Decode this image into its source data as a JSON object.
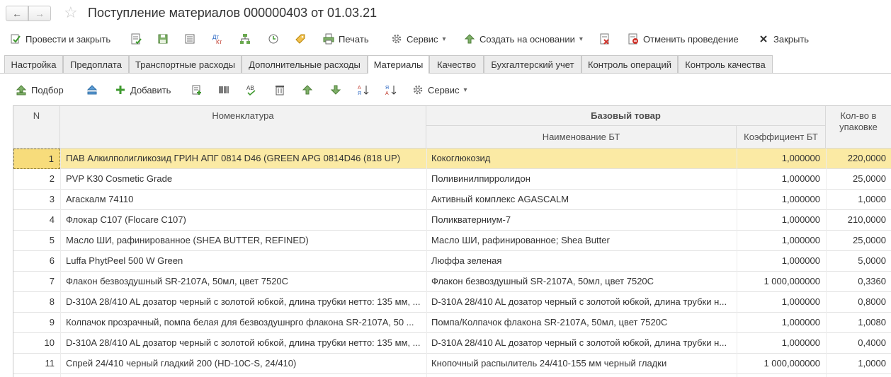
{
  "title": "Поступление материалов 000000403 от 01.03.21",
  "nav": {
    "back": "←",
    "forward": "→",
    "star": "☆"
  },
  "commands": {
    "post_close": "Провести и закрыть",
    "print": "Печать",
    "service": "Сервис",
    "create_based": "Создать на основании",
    "cancel_post": "Отменить проведение",
    "close": "Закрыть",
    "dropdown": "▾"
  },
  "tabs": [
    "Настройка",
    "Предоплата",
    "Транспортные расходы",
    "Дополнительные расходы",
    "Материалы",
    "Качество",
    "Бухгалтерский учет",
    "Контроль операций",
    "Контроль качества"
  ],
  "active_tab": "Материалы",
  "table_toolbar": {
    "pick": "Подбор",
    "add": "Добавить",
    "service": "Сервис"
  },
  "table": {
    "columns": {
      "n": "N",
      "nomenclature": "Номенклатура",
      "base_group": "Базовый товар",
      "base_name": "Наименование БТ",
      "base_coef": "Коэффициент БТ",
      "qty": "Кол-во в упаковке"
    },
    "rows": [
      {
        "n": "1",
        "name": "ПАВ Алкилполигликозид ГРИН АПГ 0814 D46 (GREEN APG 0814D46 (818 UP)",
        "bt": "Кокоглюкозид",
        "coef": "1,000000",
        "qty": "220,0000"
      },
      {
        "n": "2",
        "name": "PVP K30 Cosmetic Grade",
        "bt": "Поливинилпирролидон",
        "coef": "1,000000",
        "qty": "25,0000"
      },
      {
        "n": "3",
        "name": "Агаскалм 74110",
        "bt": "Активный комплекс AGASCALM",
        "coef": "1,000000",
        "qty": "1,0000"
      },
      {
        "n": "4",
        "name": "Флокар С107 (Flocare C107)",
        "bt": "Поликватерниум-7",
        "coef": "1,000000",
        "qty": "210,0000"
      },
      {
        "n": "5",
        "name": "Масло ШИ, рафинированное (SHEA BUTTER, REFINED)",
        "bt": "Масло ШИ, рафинированное; Shea Butter",
        "coef": "1,000000",
        "qty": "25,0000"
      },
      {
        "n": "6",
        "name": "Luffa PhytPeel 500 W Green",
        "bt": "Люффа зеленая",
        "coef": "1,000000",
        "qty": "5,0000"
      },
      {
        "n": "7",
        "name": "Флакон безвоздушный SR-2107A, 50мл, цвет 7520C",
        "bt": "Флакон безвоздушный SR-2107A, 50мл, цвет 7520C",
        "coef": "1 000,000000",
        "qty": "0,3360"
      },
      {
        "n": "8",
        "name": "D-310A 28/410 AL дозатор черный с золотой юбкой, длина трубки нетто: 135 мм, ...",
        "bt": "D-310A 28/410 AL дозатор черный с золотой юбкой, длина трубки н...",
        "coef": "1,000000",
        "qty": "0,8000"
      },
      {
        "n": "9",
        "name": "Колпачок прозрачный, помпа белая для безвоздушнрго флакона SR-2107A, 50 ...",
        "bt": "Помпа/Колпачок флакона SR-2107A, 50мл, цвет 7520C",
        "coef": "1,000000",
        "qty": "1,0080"
      },
      {
        "n": "10",
        "name": "D-310A 28/410 AL дозатор черный с золотой юбкой, длина трубки нетто: 135 мм, ...",
        "bt": "D-310A 28/410 AL дозатор черный с золотой юбкой, длина трубки н...",
        "coef": "1,000000",
        "qty": "0,4000"
      },
      {
        "n": "11",
        "name": "Спрей 24/410 черный гладкий 200 (HD-10C-S, 24/410)",
        "bt": "Кнопочный распылитель 24/410-155 мм черный гладки",
        "coef": "1 000,000000",
        "qty": "1,0000"
      }
    ]
  },
  "colors": {
    "selected_row": "#fbeaa4",
    "header_bg": "#f2f2f2",
    "green_icon": "#3f9a2f"
  }
}
